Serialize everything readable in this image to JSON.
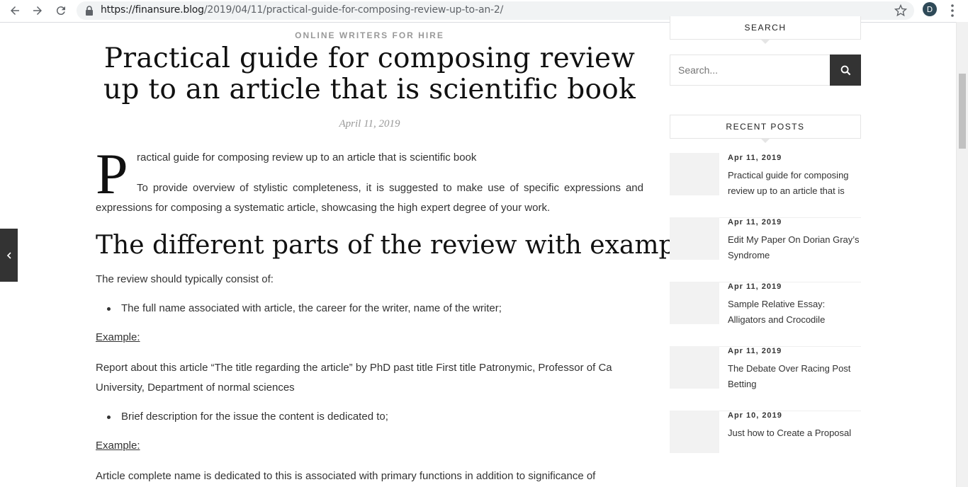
{
  "browser": {
    "url_host": "https://finansure.blog",
    "url_path": "/2019/04/11/practical-guide-for-composing-review-up-to-an-2/",
    "profile_initial": "D"
  },
  "post": {
    "category": "ONLINE WRITERS FOR HIRE",
    "title": "Practical guide for composing review up to an article that is scientific book",
    "date": "April 11, 2019",
    "dropcap": "P",
    "first_line": "ractical guide for composing review up to an article that is scientific book",
    "intro": "To provide overview of stylistic completeness, it is suggested to make use of specific expressions and expressions for composing a systematic article, showcasing the high expert degree of your work.",
    "heading": "The different parts of the review with examples",
    "review_consists": "The review should typically consist of:",
    "bullet_1": "The full name associated with article, the career for the writer, name of the writer;",
    "example_1_label": "Example:",
    "example_1_text": "Report about this article “The title regarding the article” by PhD past title First title Patronymic, Professor of Ca University, Department of normal sciences",
    "bullet_2": "Brief description for the issue the content is dedicated to;",
    "example_2_label": "Example:",
    "last_line": "Article complete name is dedicated to this is associated with primary functions in addition to significance of"
  },
  "sidebar": {
    "search_title": "SEARCH",
    "search_placeholder": "Search...",
    "recent_title": "RECENT POSTS",
    "recent_posts": [
      {
        "date": "Apr 11, 2019",
        "title": "Practical guide for composing review up to an article that is"
      },
      {
        "date": "Apr 11, 2019",
        "title": "Edit My Paper On Dorian Gray’s Syndrome"
      },
      {
        "date": "Apr 11, 2019",
        "title": "Sample Relative Essay: Alligators and Crocodile"
      },
      {
        "date": "Apr 11, 2019",
        "title": "The Debate Over Racing Post Betting"
      },
      {
        "date": "Apr 10, 2019",
        "title": "Just how to Create a Proposal"
      }
    ]
  },
  "icons": {
    "back": "arrow-left-icon",
    "forward": "arrow-right-icon",
    "reload": "reload-icon",
    "lock": "lock-icon",
    "bookmark": "star-icon",
    "menu": "more-vert-icon",
    "search": "search-icon",
    "slide_tab": "chevron-left-icon"
  }
}
